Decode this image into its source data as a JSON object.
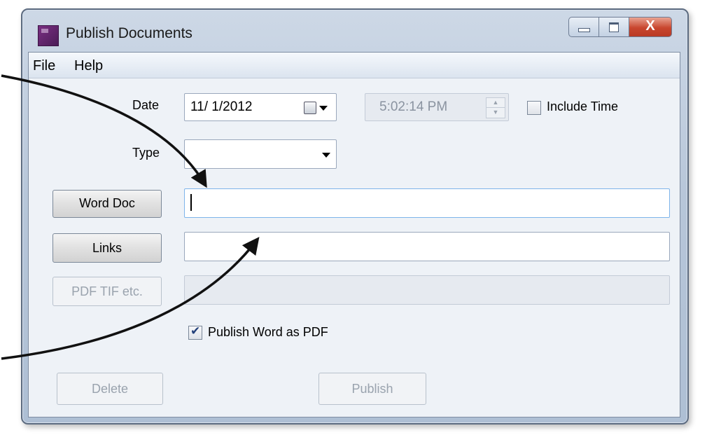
{
  "window": {
    "title": "Publish Documents",
    "controls": {
      "close_label": "X"
    }
  },
  "menu": {
    "items": [
      "File",
      "Help"
    ]
  },
  "form": {
    "date_label": "Date",
    "date_value": "11/ 1/2012",
    "time_value": "5:02:14 PM",
    "include_time_label": "Include Time",
    "include_time_checked": false,
    "type_label": "Type",
    "type_value": "",
    "word_doc_button": "Word Doc",
    "word_doc_value": "",
    "links_button": "Links",
    "links_value": "",
    "pdf_button": "PDF TIF etc.",
    "pdf_value": "",
    "publish_word_pdf_label": "Publish Word as PDF",
    "publish_word_pdf_checked": true,
    "delete_button": "Delete",
    "publish_button": "Publish"
  },
  "colors": {
    "annotation_arrow": "#111111",
    "title_bar": "#b7c6d9",
    "close_button": "#c8462e"
  }
}
